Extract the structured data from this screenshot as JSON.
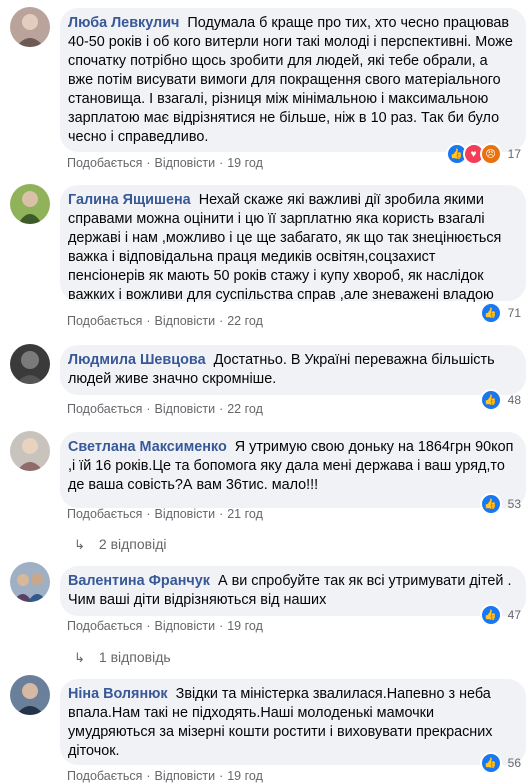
{
  "comments": [
    {
      "author": "Люба Левкулич",
      "text": "Подумала б краще про тих, хто чесно працював 40-50 років і об кого витерли ноги такі молоді і перспективні. Може спочатку потрібно щось зробити для людей, які тебе обрали, а вже потім висувати вимоги для покращення свого матеріального становища. І взагалі, різниця між мінімальною і максимальною зарплатою має відрізнятися не більше, ніж в 10 раз. Так би було чесно і справедливо.",
      "like": "Подобається",
      "reply": "Відповісти",
      "time": "19 год",
      "reaction_count": "17",
      "reaction_icons": [
        "like-icon",
        "love-icon",
        "angry-icon"
      ]
    },
    {
      "author": "Галина Ящишена",
      "text": "Нехай скаже які важливі дії зробила якими справами можна оцінити і цю її зарплатню яка користь взагалі державі і нам ,можливо і це ще забагато, як що так знецінюється важка і відповідальна праця медиків освітян,соцзахист пенсіонерів як мають 50 років стажу і купу хвороб, як наслідок важких і вожливи для суспільства справ ,але зневажені владою",
      "like": "Подобається",
      "reply": "Відповісти",
      "time": "22 год",
      "reaction_count": "71",
      "reaction_icons": [
        "like-icon"
      ]
    },
    {
      "author": "Людмила Шевцова",
      "text": "Достатньо. В Україні переважна більшість людей живе значно скромніше.",
      "like": "Подобається",
      "reply": "Відповісти",
      "time": "22 год",
      "reaction_count": "48",
      "reaction_icons": [
        "like-icon"
      ]
    },
    {
      "author": "Светлана Максименко",
      "text": "Я утримую свою доньку на 1864грн 90коп ,і їй 16 років.Це та бопомога яку дала мені держава і ваш уряд,то де ваша совість?А вам 36тис. мало!!!",
      "like": "Подобається",
      "reply": "Відповісти",
      "time": "21 год",
      "reaction_count": "53",
      "reaction_icons": [
        "like-icon"
      ],
      "replies": "2 відповіді"
    },
    {
      "author": "Валентина Франчук",
      "text": "А ви спробуйте так як всі утримувати дітей . Чим ваші діти відрізняються від наших",
      "like": "Подобається",
      "reply": "Відповісти",
      "time": "19 год",
      "reaction_count": "47",
      "reaction_icons": [
        "like-icon"
      ],
      "replies": "1 відповідь"
    },
    {
      "author": "Ніна Волянюк",
      "text": "Звідки та міністерка звалилася.Напевно з неба впала.Нам такі не підходять.Наші молоденькі мамочки умудряються за мізерні кошти ростити і виховувати прекрасних діточок.",
      "like": "Подобається",
      "reply": "Відповісти",
      "time": "19 год",
      "reaction_count": "56",
      "reaction_icons": [
        "like-icon"
      ]
    }
  ],
  "colors": {
    "author": "#385898",
    "bubble": "#f0f2f5",
    "meta": "#65676b",
    "like": "#1877f2",
    "love": "#f33e58",
    "angry": "#e9710f"
  }
}
